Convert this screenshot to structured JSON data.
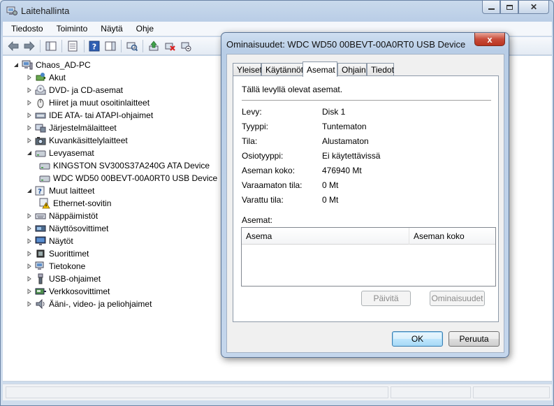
{
  "window": {
    "title": "Laitehallinta"
  },
  "menu": [
    "Tiedosto",
    "Toiminto",
    "Näytä",
    "Ohje"
  ],
  "tree": {
    "root": "Chaos_AD-PC",
    "items": [
      {
        "label": "Akut",
        "icon": "battery-icon"
      },
      {
        "label": "DVD- ja CD-asemat",
        "icon": "disc-drive-icon"
      },
      {
        "label": "Hiiret ja muut osoitinlaitteet",
        "icon": "mouse-icon"
      },
      {
        "label": "IDE ATA- tai ATAPI-ohjaimet",
        "icon": "ide-controller-icon"
      },
      {
        "label": "Järjestelmälaitteet",
        "icon": "system-device-icon"
      },
      {
        "label": "Kuvankäsittelylaitteet",
        "icon": "camera-icon"
      },
      {
        "label": "Levyasemat",
        "icon": "disk-drive-icon"
      },
      {
        "label": "KINGSTON SV300S37A240G ATA Device",
        "icon": "disk-drive-icon"
      },
      {
        "label": "WDC WD50 00BEVT-00A0RT0 USB Device",
        "icon": "disk-drive-icon"
      },
      {
        "label": "Muut laitteet",
        "icon": "unknown-device-icon"
      },
      {
        "label": "Ethernet-sovitin",
        "icon": "warning-device-icon"
      },
      {
        "label": "Näppäimistöt",
        "icon": "keyboard-icon"
      },
      {
        "label": "Näyttösovittimet",
        "icon": "display-adapter-icon"
      },
      {
        "label": "Näytöt",
        "icon": "monitor-icon"
      },
      {
        "label": "Suorittimet",
        "icon": "processor-icon"
      },
      {
        "label": "Tietokone",
        "icon": "computer-icon"
      },
      {
        "label": "USB-ohjaimet",
        "icon": "usb-icon"
      },
      {
        "label": "Verkkosovittimet",
        "icon": "network-adapter-icon"
      },
      {
        "label": "Ääni-, video- ja peliohjaimet",
        "icon": "speaker-icon"
      }
    ]
  },
  "dialog": {
    "title": "Ominaisuudet: WDC WD50 00BEVT-00A0RT0 USB Device",
    "close_label": "x",
    "tabs": [
      "Yleiset",
      "Käytännöt",
      "Asemat",
      "Ohjain",
      "Tiedot"
    ],
    "active_tab": "Asemat",
    "intro": "Tällä levyllä olevat asemat.",
    "properties": [
      {
        "label": "Levy:",
        "value": "Disk 1"
      },
      {
        "label": "Tyyppi:",
        "value": "Tuntematon"
      },
      {
        "label": "Tila:",
        "value": "Alustamaton"
      },
      {
        "label": "Osiotyyppi:",
        "value": "Ei käytettävissä"
      },
      {
        "label": "Aseman koko:",
        "value": "476940 Mt"
      },
      {
        "label": "Varaamaton tila:",
        "value": "0 Mt"
      },
      {
        "label": "Varattu tila:",
        "value": "0 Mt"
      }
    ],
    "volumes_label": "Asemat:",
    "volumes_columns": [
      "Asema",
      "Aseman koko"
    ],
    "refresh_button": "Päivitä",
    "properties_button": "Ominaisuudet",
    "ok_button": "OK",
    "cancel_button": "Peruuta"
  }
}
